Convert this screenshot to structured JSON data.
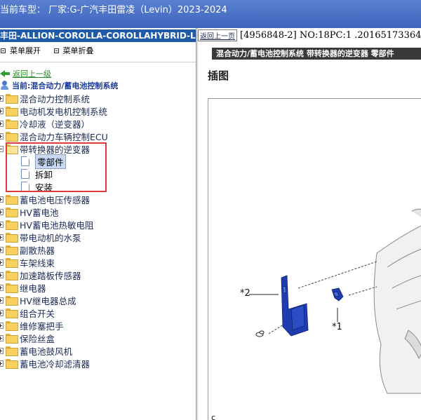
{
  "window": {
    "title": "当前车型：  厂家:G-广汽丰田雷凌（Levin）2023-2024"
  },
  "left": {
    "header": "丰田-ALLION-COROLLA-COROLLAHYBRID-LEVIN-L",
    "menu": {
      "expand_label": "菜单展开",
      "collapse_label": "菜单折叠"
    },
    "back_label": "返回上一级",
    "current_label": "当前:混合动力/蓄电池控制系统",
    "tree": {
      "items_before": [
        {
          "label": "混合动力控制系统"
        },
        {
          "label": "电动机发电机控制系统"
        },
        {
          "label": "冷却液（逆变器）"
        },
        {
          "label": "混合动力车辆控制ECU"
        }
      ],
      "open_item": {
        "label": "带转换器的逆变器",
        "children": [
          {
            "label": "零部件"
          },
          {
            "label": "拆卸"
          },
          {
            "label": "安装"
          }
        ]
      },
      "items_after": [
        {
          "label": "蓄电池电压传感器"
        },
        {
          "label": "HV蓄电池"
        },
        {
          "label": "HV蓄电池热敏电阻"
        },
        {
          "label": "带电动机的水泵"
        },
        {
          "label": "副散热器"
        },
        {
          "label": "车架线束"
        },
        {
          "label": "加速踏板传感器"
        },
        {
          "label": "继电器"
        },
        {
          "label": "HV继电器总成"
        },
        {
          "label": "组合开关"
        },
        {
          "label": "维修塞把手"
        },
        {
          "label": "保险丝盒"
        },
        {
          "label": "蓄电池鼓风机"
        },
        {
          "label": "蓄电池冷却滤清器"
        }
      ]
    }
  },
  "right": {
    "back_button": "返回上一页",
    "doc_ref": "[4956848-2] NO:18PC:1 .20165173364",
    "breadcrumb": "混合动力/蓄电池控制系统 带转换器的逆变器 零部件",
    "section_title": "插图",
    "figure": {
      "callout_2": "*2",
      "callout_1": "*1",
      "corner_label": "c"
    }
  },
  "colors": {
    "titlebar": "#4a72c6",
    "left_header": "#1f5aa8",
    "breadcrumb_bg": "#3a3a3a",
    "highlight": "#e03a3a",
    "part_blue": "#1f3db0"
  }
}
